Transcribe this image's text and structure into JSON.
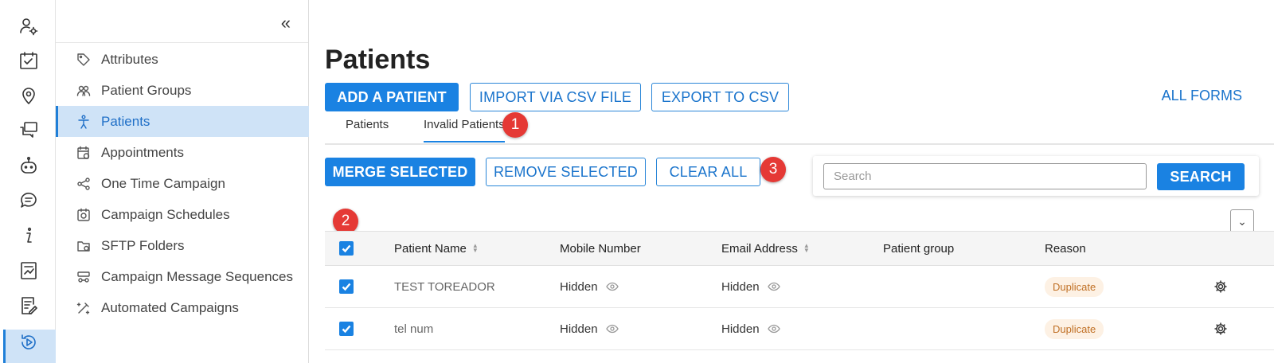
{
  "rail": {
    "icons": [
      "user-settings-icon",
      "calendar-check-icon",
      "map-pin-icon",
      "chat-bubbles-icon",
      "robot-icon",
      "message-icon",
      "info-icon",
      "report-icon",
      "edit-form-icon",
      "campaign-play-icon"
    ]
  },
  "nav": {
    "collapse": "«",
    "items": [
      {
        "label": "Attributes",
        "icon": "tag-icon"
      },
      {
        "label": "Patient Groups",
        "icon": "group-icon"
      },
      {
        "label": "Patients",
        "icon": "person-icon"
      },
      {
        "label": "Appointments",
        "icon": "calendar-icon"
      },
      {
        "label": "One Time Campaign",
        "icon": "share-icon"
      },
      {
        "label": "Campaign Schedules",
        "icon": "schedule-icon"
      },
      {
        "label": "SFTP Folders",
        "icon": "folder-icon"
      },
      {
        "label": "Campaign Message Sequences",
        "icon": "sequence-icon"
      },
      {
        "label": "Automated Campaigns",
        "icon": "automation-icon"
      }
    ]
  },
  "main": {
    "title": "Patients",
    "actions": {
      "add": "ADD A PATIENT",
      "import": "IMPORT VIA CSV FILE",
      "export": "EXPORT TO CSV",
      "all_forms": "ALL FORMS"
    },
    "tabs": [
      {
        "label": "Patients"
      },
      {
        "label": "Invalid Patients"
      }
    ],
    "bulk": {
      "merge": "MERGE SELECTED",
      "remove": "REMOVE SELECTED",
      "clear": "CLEAR ALL"
    },
    "search": {
      "placeholder": "Search",
      "button": "SEARCH"
    },
    "callouts": [
      "1",
      "2",
      "3"
    ],
    "table": {
      "headers": [
        "Patient Name",
        "Mobile Number",
        "Email Address",
        "Patient group",
        "Reason"
      ],
      "rows": [
        {
          "name": "TEST TOREADOR",
          "mobile": "Hidden",
          "email": "Hidden",
          "group": "",
          "reason": "Duplicate"
        },
        {
          "name": "tel num",
          "mobile": "Hidden",
          "email": "Hidden",
          "group": "",
          "reason": "Duplicate"
        }
      ]
    }
  },
  "colors": {
    "primary": "#1a82e2",
    "active_bg": "#cfe3f7",
    "callout": "#e53935",
    "duplicate_bg": "#fdf1e4",
    "duplicate_text": "#c07025"
  }
}
